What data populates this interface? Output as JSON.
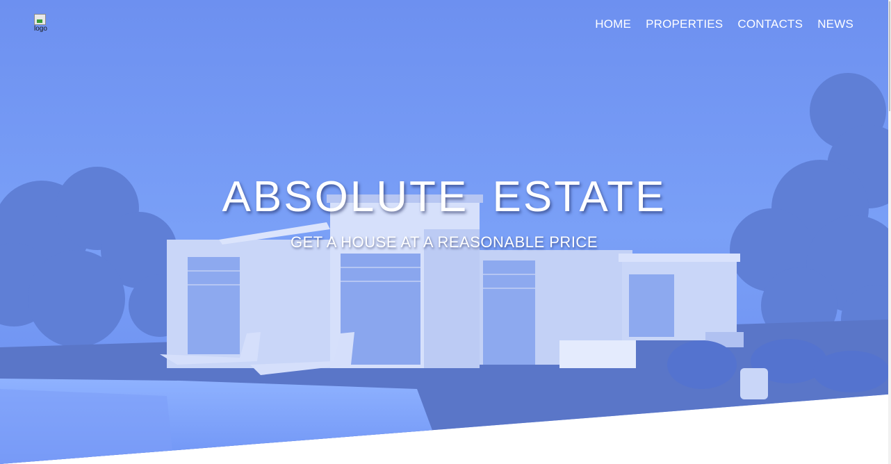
{
  "header": {
    "logo_alt": "logo"
  },
  "nav": {
    "items": [
      {
        "label": "HOME"
      },
      {
        "label": "PROPERTIES"
      },
      {
        "label": "CONTACTS"
      },
      {
        "label": "NEWS"
      }
    ]
  },
  "hero": {
    "title": "ABSOLUTE ESTATE",
    "subtitle": "GET A HOUSE AT A REASONABLE PRICE",
    "overlay_color": "#6b8ff0"
  }
}
